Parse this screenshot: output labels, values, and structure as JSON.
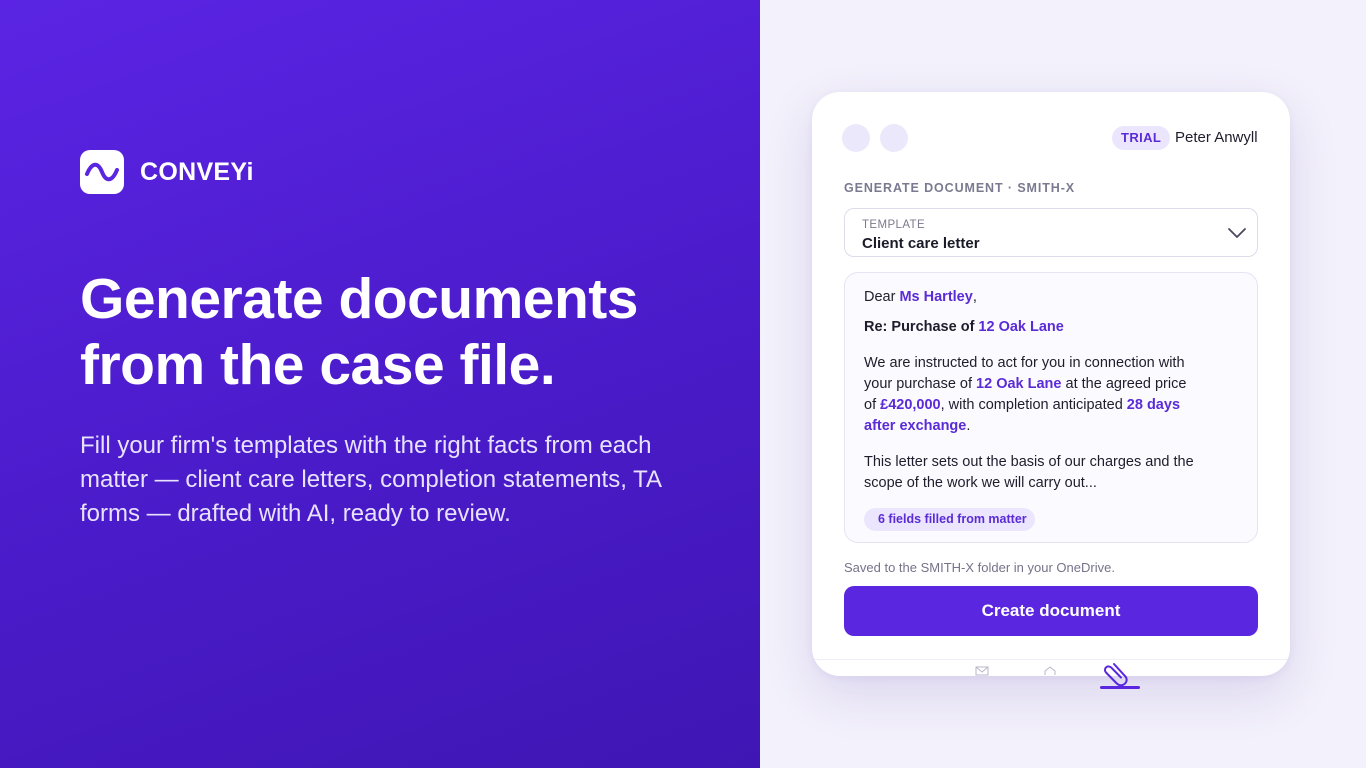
{
  "brand": {
    "name": "CONVEYi"
  },
  "hero": {
    "headline": "Generate documents from the case file.",
    "subline": "Fill your firm's templates with the right facts from each matter — client care letters, completion statements, TA forms — drafted with AI, ready to review."
  },
  "panel": {
    "trial_badge": "TRIAL",
    "user_name": "Peter Anwyll",
    "section_title": "GENERATE DOCUMENT · SMITH-X",
    "template": {
      "label": "TEMPLATE",
      "value": "Client care letter"
    },
    "preview": {
      "dear_prefix": "Dear ",
      "client_name": "Ms Hartley",
      "dear_suffix": ",",
      "re_prefix": "Re: Purchase of ",
      "property": "12 Oak Lane",
      "p1_a": "We are instructed to act for you in connection with your purchase of ",
      "p1_b": " at the agreed price of ",
      "price": "£420,000",
      "p1_c": ", with completion anticipated ",
      "completion": "28 days after exchange",
      "p1_d": ".",
      "p2": "This letter sets out the basis of our charges and the scope of the work we will carry out...",
      "fields_pill": "6 fields filled from matter"
    },
    "saved_note": "Saved to the SMITH-X folder in your OneDrive.",
    "create_button": "Create document"
  },
  "colors": {
    "accent": "#5a26df",
    "hero_start": "#5b24e4",
    "hero_end": "#3f16b4"
  },
  "icons": [
    "logo-wave-icon",
    "chevron-down-icon",
    "mail-icon",
    "home-icon",
    "paperclip-icon"
  ]
}
